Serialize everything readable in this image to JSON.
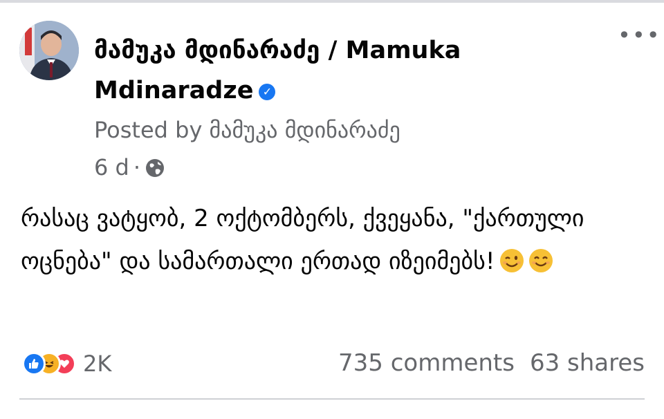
{
  "post": {
    "author_name": "მამუკა მდინარაძე / Mamuka Mdinaradze",
    "posted_by": "Posted by მამუკა მდინარაძე",
    "time": "6 d",
    "separator": "·",
    "privacy_icon": "globe-icon",
    "verified_icon": "verified-badge-icon",
    "more_label": "•••",
    "text": "რასაც ვატყობ, 2 ოქტომბერს, ქვეყანა, \"ქართული ოცნება\" და სამართალი ერთად იზეიმებს!",
    "emojis": [
      "winking-face-icon",
      "smiling-face-icon"
    ]
  },
  "engagement": {
    "reaction_icons": [
      "like-icon",
      "haha-icon",
      "love-icon"
    ],
    "reaction_count": "2K",
    "comments": "735 comments",
    "shares": "63 shares"
  },
  "colors": {
    "accent": "#1877f2",
    "secondary_text": "#65676b",
    "love": "#f33e58",
    "haha": "#f7b125"
  }
}
